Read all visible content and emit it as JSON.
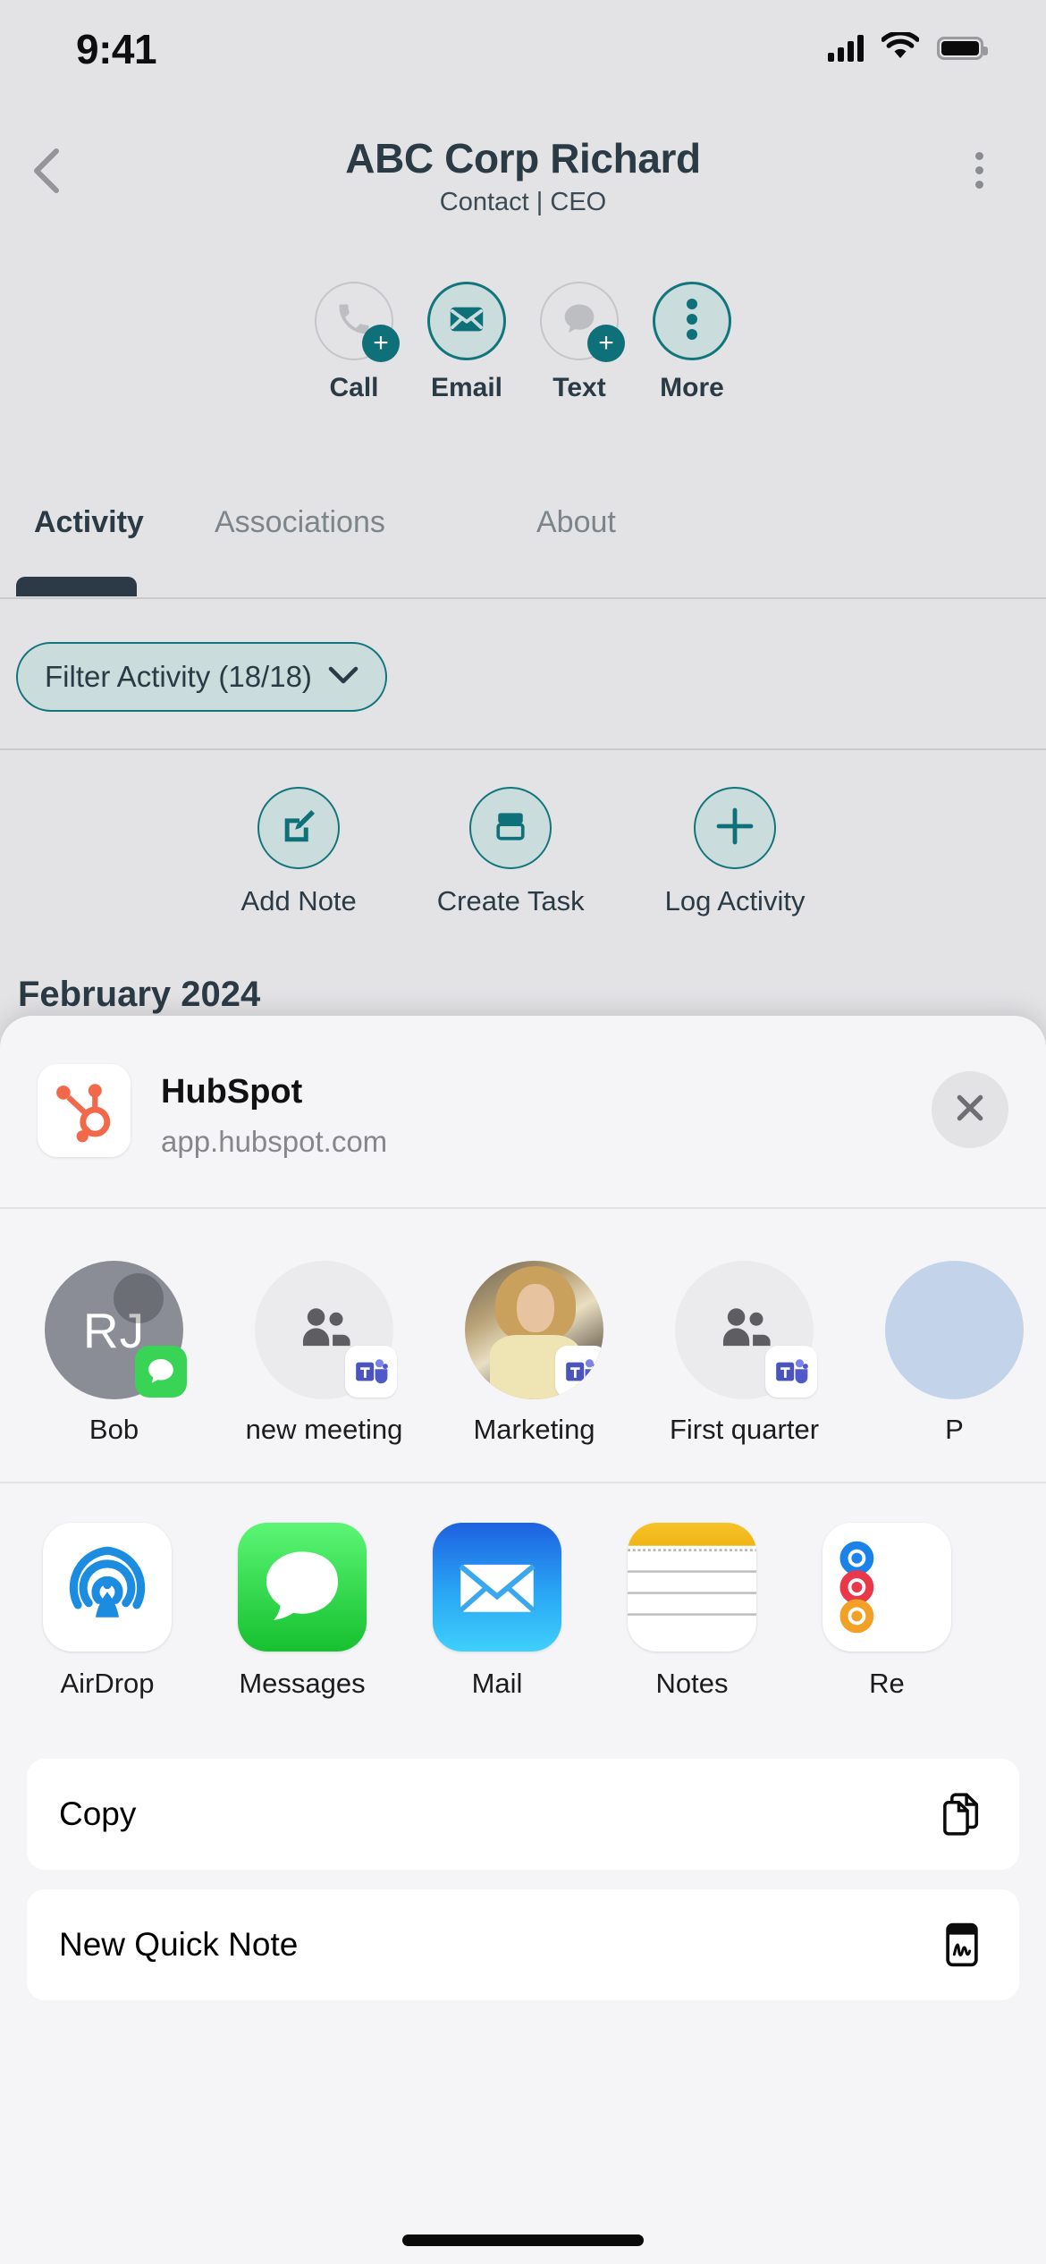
{
  "status_bar": {
    "time": "9:41",
    "signal_icon": "cellular-bars-icon",
    "wifi_icon": "wifi-icon",
    "battery_icon": "battery-full-icon"
  },
  "nav": {
    "back_icon": "chevron-left-icon",
    "title": "ABC Corp Richard",
    "subtitle": "Contact | CEO",
    "overflow_icon": "overflow-menu-icon"
  },
  "quick_actions": [
    {
      "label": "Call",
      "icon": "phone-icon",
      "state": "outline",
      "badge": "+"
    },
    {
      "label": "Email",
      "icon": "envelope-icon",
      "state": "filled",
      "badge": ""
    },
    {
      "label": "Text",
      "icon": "chat-bubble-icon",
      "state": "outline",
      "badge": "+"
    },
    {
      "label": "More",
      "icon": "more-dots-icon",
      "state": "filled",
      "badge": ""
    }
  ],
  "tabs": [
    {
      "label": "Activity",
      "active": true
    },
    {
      "label": "Associations",
      "active": false
    },
    {
      "label": "About",
      "active": false
    }
  ],
  "filter": {
    "label": "Filter Activity (18/18)",
    "chevron_icon": "chevron-down-icon"
  },
  "create_actions": [
    {
      "label": "Add Note",
      "icon": "pencil-square-icon"
    },
    {
      "label": "Create Task",
      "icon": "task-card-icon"
    },
    {
      "label": "Log Activity",
      "icon": "plus-icon"
    }
  ],
  "timeline": {
    "month_heading": "February 2024"
  },
  "share_sheet": {
    "app_name": "HubSpot",
    "app_url": "app.hubspot.com",
    "app_icon": "hubspot-logo-icon",
    "close_icon": "close-x-icon",
    "contacts": [
      {
        "label": "Bob",
        "avatar_type": "initials",
        "initials": "RJ",
        "badge": "messages-badge-icon"
      },
      {
        "label": "new meeting",
        "avatar_type": "people",
        "initials": "",
        "badge": "teams-badge-icon"
      },
      {
        "label": "Marketing",
        "avatar_type": "photo",
        "initials": "",
        "badge": "teams-badge-icon"
      },
      {
        "label": "First quarter",
        "avatar_type": "people",
        "initials": "",
        "badge": "teams-badge-icon"
      },
      {
        "label": "P",
        "avatar_type": "blue",
        "initials": "",
        "badge": ""
      }
    ],
    "apps": [
      {
        "label": "AirDrop",
        "icon": "airdrop-icon"
      },
      {
        "label": "Messages",
        "icon": "messages-icon"
      },
      {
        "label": "Mail",
        "icon": "mail-icon"
      },
      {
        "label": "Notes",
        "icon": "notes-icon"
      },
      {
        "label": "Re",
        "icon": "reminders-icon"
      }
    ],
    "actions": [
      {
        "label": "Copy",
        "icon": "copy-icon"
      },
      {
        "label": "New Quick Note",
        "icon": "quick-note-icon"
      }
    ]
  },
  "colors": {
    "teal": "#0e7078",
    "teal_fill": "#cbdcdc",
    "dark_text": "#2b3b46",
    "hubspot_orange": "#f2684a",
    "messages_green": "#39d455",
    "teams_purple": "#5058c8",
    "app_bg": "#e3e2e5",
    "sheet_bg": "#f5f5f7"
  }
}
